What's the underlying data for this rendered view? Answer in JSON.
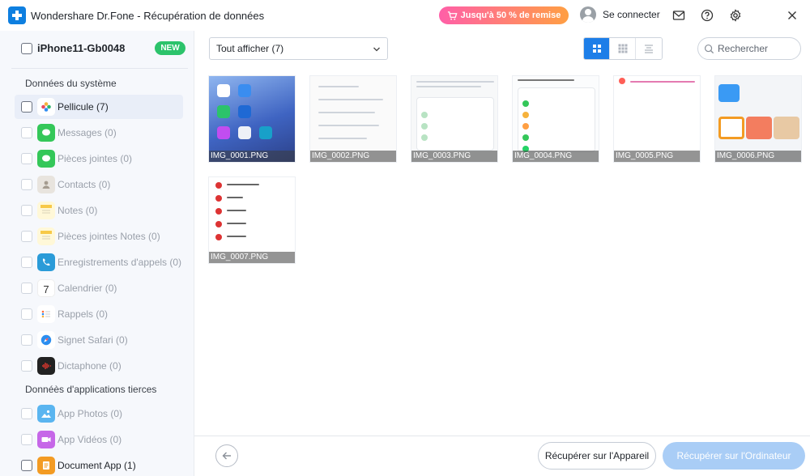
{
  "titlebar": {
    "app_name": "Wondershare Dr.Fone",
    "separator": " - ",
    "module": "Récupération de données",
    "promo": "Jusqu'à 50 % de remise",
    "login": "Se connecter"
  },
  "sidebar": {
    "device_name": "iPhone11-Gb0048",
    "new_badge": "NEW",
    "system_section": "Données du système",
    "system_items": [
      {
        "label": "Pellicule (7)"
      },
      {
        "label": "Messages (0)"
      },
      {
        "label": "Pièces jointes (0)"
      },
      {
        "label": "Contacts (0)"
      },
      {
        "label": "Notes (0)"
      },
      {
        "label": "Pièces jointes Notes (0)"
      },
      {
        "label": "Enregistrements d'appels (0)"
      },
      {
        "label": "Calendrier (0)"
      },
      {
        "label": "Rappels (0)"
      },
      {
        "label": "Signet Safari (0)"
      },
      {
        "label": "Dictaphone (0)"
      }
    ],
    "calendar_day": "7",
    "third_party_section": "Donnéès d'applications tierces",
    "third_party_items": [
      {
        "label": "App Photos (0)"
      },
      {
        "label": "App Vidéos (0)"
      },
      {
        "label": "Document App (1)"
      }
    ]
  },
  "toolbar": {
    "filter_value": "Tout afficher (7)",
    "search_placeholder": "Rechercher"
  },
  "thumbnails": [
    {
      "name": "IMG_0001.PNG"
    },
    {
      "name": "IMG_0002.PNG"
    },
    {
      "name": "IMG_0003.PNG"
    },
    {
      "name": "IMG_0004.PNG"
    },
    {
      "name": "IMG_0005.PNG"
    },
    {
      "name": "IMG_0006.PNG"
    },
    {
      "name": "IMG_0007.PNG"
    }
  ],
  "footer": {
    "recover_device": "Récupérer sur l'Appareil",
    "recover_computer": "Récupérer sur l'Ordinateur"
  },
  "colors": {
    "accent": "#1d7ee8",
    "promo_start": "#ff5fa8",
    "promo_end": "#ff9f43",
    "new_badge": "#2cc36b",
    "disabled_button": "#a9cdf6"
  }
}
